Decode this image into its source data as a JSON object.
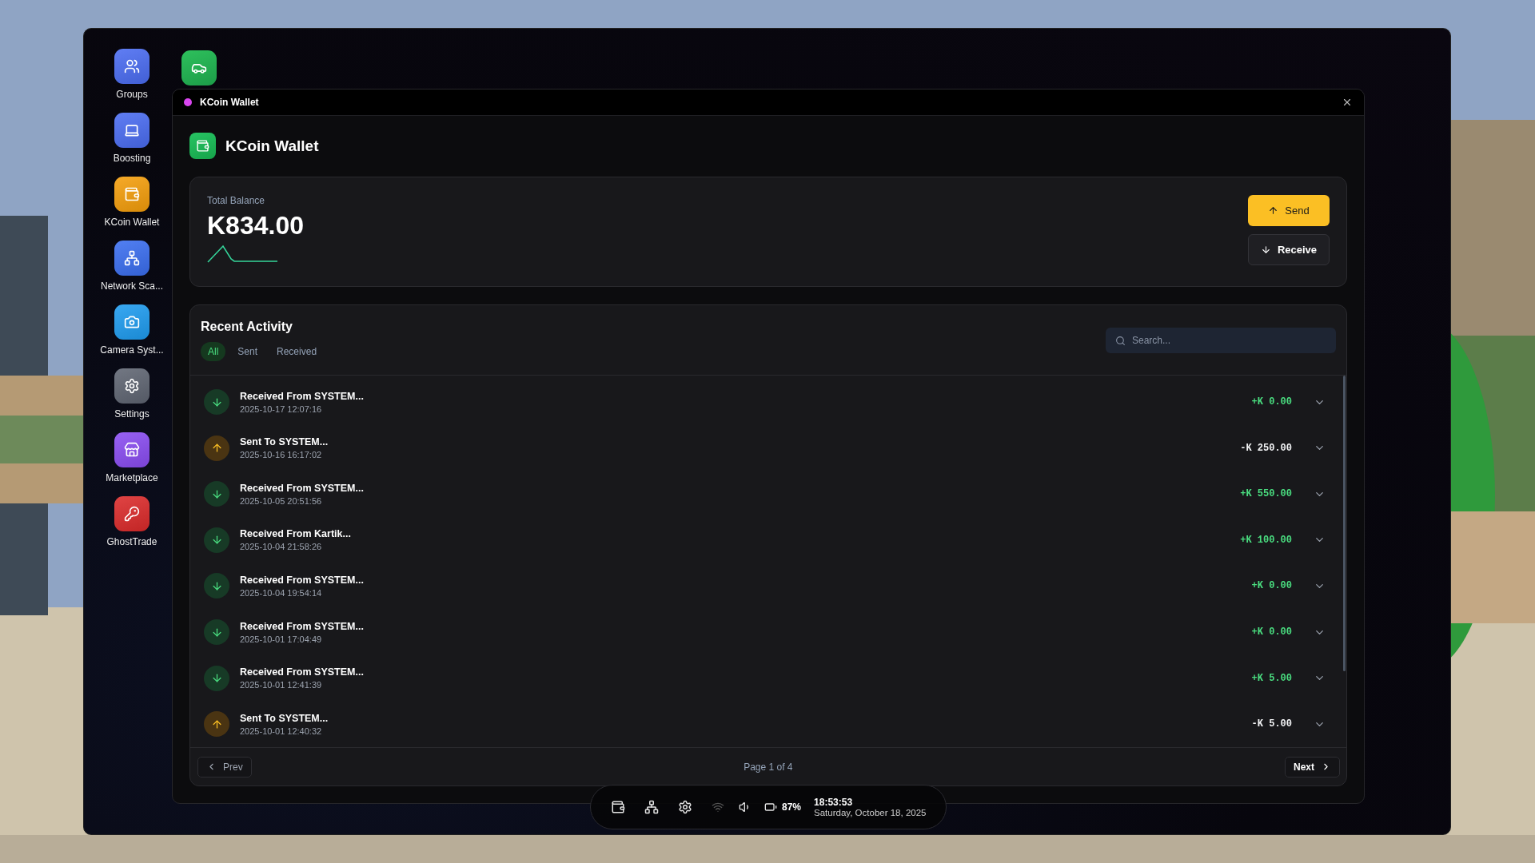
{
  "desktop_apps": [
    {
      "label": "Groups",
      "color": "#4a6cf2"
    },
    {
      "label": "Boosting",
      "color": "#4a6cf2"
    },
    {
      "label": "KCoin Wallet",
      "color": "#f59e0b"
    },
    {
      "label": "Network Sca...",
      "color": "#3a6ef0"
    },
    {
      "label": "Camera Syst...",
      "color": "#1e9cf0"
    },
    {
      "label": "Settings",
      "color": "#5f6572"
    },
    {
      "label": "Marketplace",
      "color": "#8a4cf2"
    },
    {
      "label": "GhostTrade",
      "color": "#dc2a2a"
    }
  ],
  "window": {
    "title": "KCoin Wallet"
  },
  "header": {
    "title": "KCoin Wallet"
  },
  "balance": {
    "label": "Total Balance",
    "amount": "K834.00"
  },
  "actions": [
    {
      "kind": "send",
      "label": "Send"
    },
    {
      "kind": "receive",
      "label": "Receive"
    }
  ],
  "activity": {
    "title": "Recent Activity",
    "tabs": [
      {
        "label": "All",
        "selected": true
      },
      {
        "label": "Sent",
        "selected": false
      },
      {
        "label": "Received",
        "selected": false
      }
    ],
    "search": {
      "placeholder": "Search..."
    },
    "rows": [
      {
        "kind": "received",
        "title": "Received From SYSTEM...",
        "time": "2025-10-17 12:07:16",
        "amount": "+K 0.00"
      },
      {
        "kind": "sent",
        "title": "Sent To SYSTEM...",
        "time": "2025-10-16 16:17:02",
        "amount": "-K 250.00"
      },
      {
        "kind": "received",
        "title": "Received From SYSTEM...",
        "time": "2025-10-05 20:51:56",
        "amount": "+K 550.00"
      },
      {
        "kind": "received",
        "title": "Received From Kartik...",
        "time": "2025-10-04 21:58:26",
        "amount": "+K 100.00"
      },
      {
        "kind": "received",
        "title": "Received From SYSTEM...",
        "time": "2025-10-04 19:54:14",
        "amount": "+K 0.00"
      },
      {
        "kind": "received",
        "title": "Received From SYSTEM...",
        "time": "2025-10-01 17:04:49",
        "amount": "+K 0.00"
      },
      {
        "kind": "received",
        "title": "Received From SYSTEM...",
        "time": "2025-10-01 12:41:39",
        "amount": "+K 5.00"
      },
      {
        "kind": "sent",
        "title": "Sent To SYSTEM...",
        "time": "2025-10-01 12:40:32",
        "amount": "-K 5.00"
      }
    ],
    "pagination": {
      "prev": "Prev",
      "page": "Page 1 of 4",
      "next": "Next"
    }
  },
  "taskbar": {
    "battery": "87%",
    "time": "18:53:53",
    "date": "Saturday, October 18, 2025"
  }
}
